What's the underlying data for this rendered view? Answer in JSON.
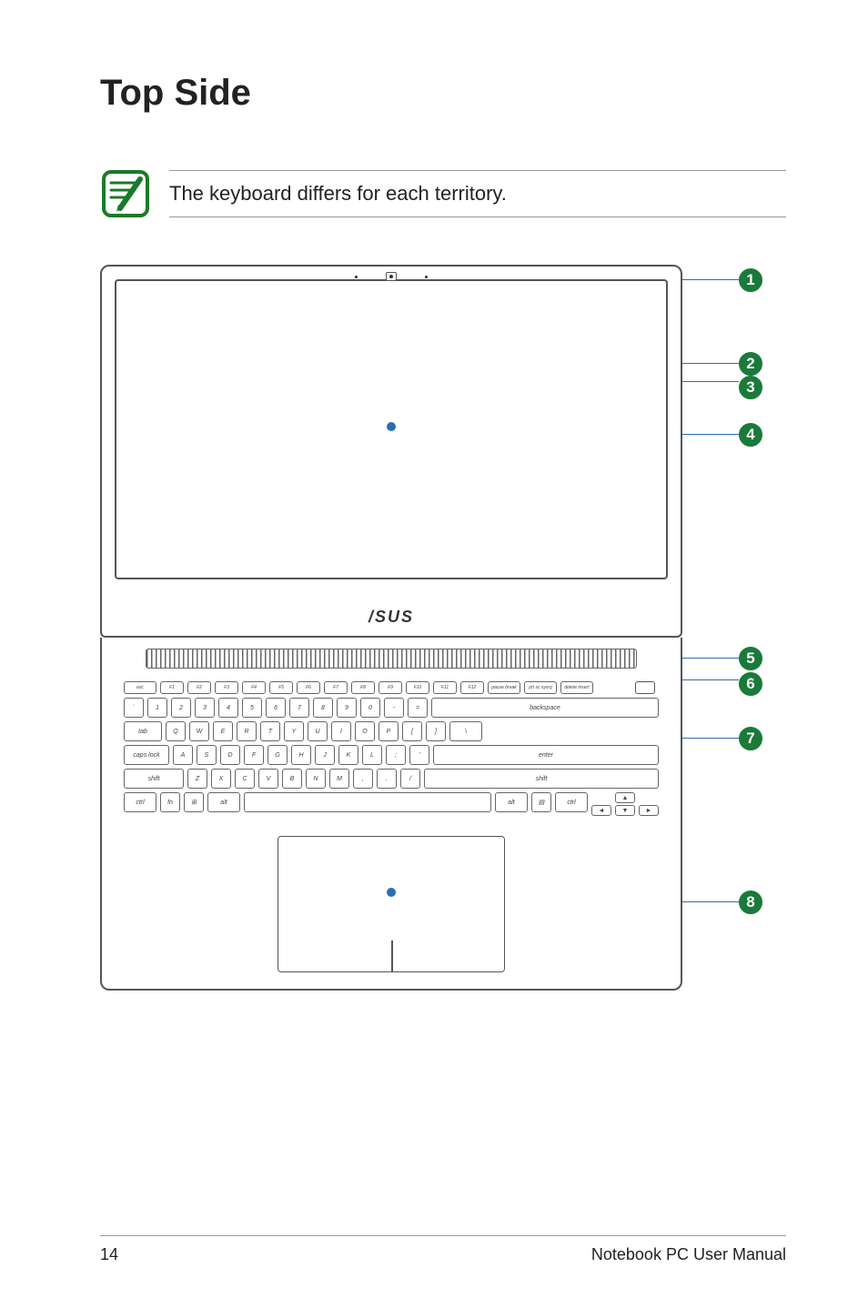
{
  "page": {
    "title": "Top Side",
    "note": "The keyboard differs for each territory.",
    "footer_page": "14",
    "footer_text": "Notebook PC User Manual",
    "brand": "/SUS"
  },
  "callouts": {
    "c1": "1",
    "c2": "2",
    "c3": "3",
    "c4": "4",
    "c5": "5",
    "c6": "6",
    "c7": "7",
    "c8": "8"
  },
  "keys": {
    "fnrow": [
      "esc",
      "F1",
      "F2",
      "F3",
      "F4",
      "F5",
      "F6",
      "F7",
      "F8",
      "F9",
      "F10",
      "F11",
      "F12",
      "pause break",
      "prt sc sysrq",
      "delete insert"
    ],
    "numrow_top": [
      "~",
      "!",
      "@",
      "#",
      "$",
      "%",
      "^",
      "&",
      "*",
      "(",
      ")",
      "_",
      "+"
    ],
    "numrow": [
      "`",
      "1",
      "2",
      "3",
      "4",
      "5",
      "6",
      "7",
      "8",
      "9",
      "0",
      "-",
      "="
    ],
    "backspace": "backspace",
    "tab": "tab",
    "qwer": [
      "Q",
      "W",
      "E",
      "R",
      "T",
      "Y",
      "U",
      "I",
      "O",
      "P",
      "[",
      "]",
      "\\"
    ],
    "caps": "caps lock",
    "asdf": [
      "A",
      "S",
      "D",
      "F",
      "G",
      "H",
      "J",
      "K",
      "L",
      ";",
      "'"
    ],
    "enter": "enter",
    "shiftL": "shift",
    "zxcv": [
      "Z",
      "X",
      "C",
      "V",
      "B",
      "N",
      "M",
      ",",
      ".",
      "/"
    ],
    "shiftR": "shift",
    "ctrl": "ctrl",
    "fn": "fn",
    "alt": "alt",
    "altR": "alt",
    "ctrlR": "ctrl",
    "arrows": {
      "up": "▲",
      "down": "▼",
      "left": "◄",
      "right": "►"
    }
  }
}
